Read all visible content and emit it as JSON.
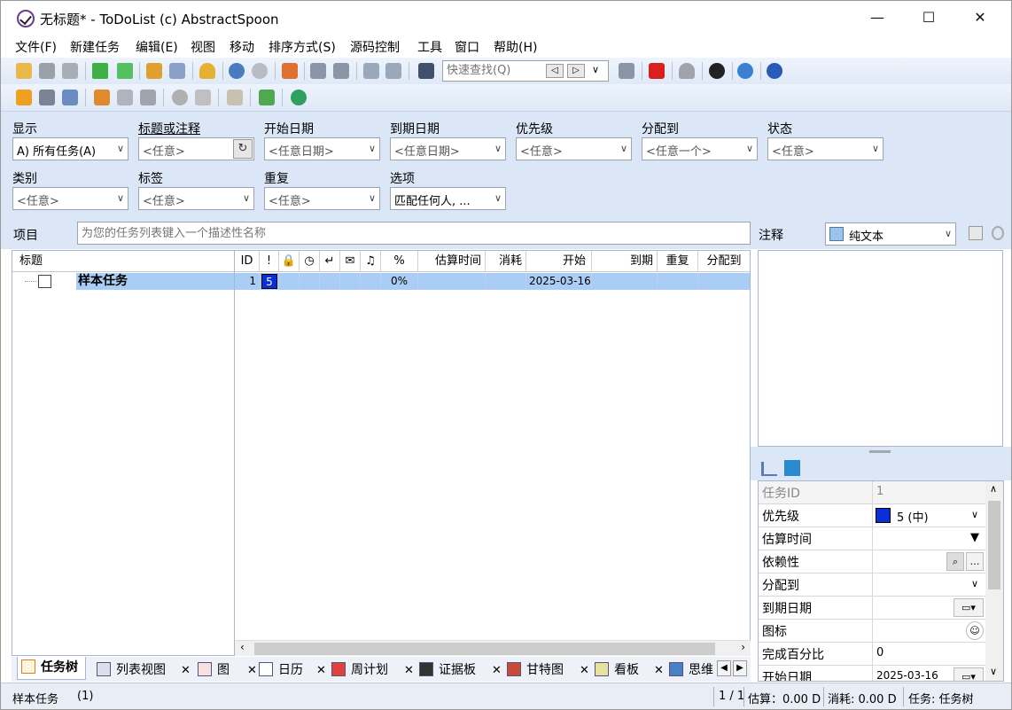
{
  "window": {
    "title": "无标题* - ToDoList (c) AbstractSpoon",
    "minimize": "—",
    "maximize": "☐",
    "close": "✕"
  },
  "menu": [
    "文件(F)",
    "新建任务",
    "编辑(E)",
    "视图",
    "移动",
    "排序方式(S)",
    "源码控制",
    "工具",
    "窗口",
    "帮助(H)"
  ],
  "quickfind": {
    "placeholder": "快速查找(Q)"
  },
  "filters": {
    "show": {
      "label": "显示",
      "value": "A) 所有任务(A)"
    },
    "title_or_comments": {
      "label": "标题或注释",
      "value": "<任意>"
    },
    "start_date": {
      "label": "开始日期",
      "value": "<任意日期>"
    },
    "due_date": {
      "label": "到期日期",
      "value": "<任意日期>"
    },
    "priority": {
      "label": "优先级",
      "value": "<任意>"
    },
    "assigned_to": {
      "label": "分配到",
      "value": "<任意一个>"
    },
    "status": {
      "label": "状态",
      "value": "<任意>"
    },
    "category": {
      "label": "类别",
      "value": "<任意>"
    },
    "tags": {
      "label": "标签",
      "value": "<任意>"
    },
    "recurrence": {
      "label": "重复",
      "value": "<任意>"
    },
    "options": {
      "label": "选项",
      "value": "匹配任何人, ..."
    }
  },
  "project": {
    "label": "项目",
    "placeholder": "为您的任务列表键入一个描述性名称"
  },
  "columns": {
    "title": "标题",
    "id": "ID",
    "pct": "%",
    "estimate": "估算时间",
    "spent": "消耗",
    "start": "开始",
    "due": "到期",
    "recur": "重复",
    "assigned": "分配到"
  },
  "task": {
    "title": "样本任务",
    "id": "1",
    "priority": "5",
    "percent": "0%",
    "start": "2025-03-16"
  },
  "tabs": [
    {
      "label": "任务树",
      "active": true
    },
    {
      "label": "列表视图"
    },
    {
      "label": "图"
    },
    {
      "label": "日历"
    },
    {
      "label": "周计划"
    },
    {
      "label": "证据板"
    },
    {
      "label": "甘特图"
    },
    {
      "label": "看板"
    },
    {
      "label": "思维"
    }
  ],
  "notes": {
    "label": "注释",
    "format": "纯文本"
  },
  "inspector": {
    "task_id": {
      "name": "任务ID",
      "value": "1"
    },
    "priority": {
      "name": "优先级",
      "value": "5 (中)"
    },
    "estimate": {
      "name": "估算时间",
      "value": ""
    },
    "dependency": {
      "name": "依赖性",
      "value": ""
    },
    "assigned": {
      "name": "分配到",
      "value": ""
    },
    "due_date": {
      "name": "到期日期",
      "value": ""
    },
    "icon": {
      "name": "图标",
      "value": ""
    },
    "percent": {
      "name": "完成百分比",
      "value": "0"
    },
    "start_date": {
      "name": "开始日期",
      "value": "2025-03-16"
    }
  },
  "status": {
    "task": "样本任务",
    "count": "(1)",
    "pages": "1 / 1",
    "estimate": "估算：0.00 D",
    "spent": "消耗: 0.00 D",
    "view": "任务: 任务树"
  },
  "colors": {
    "priority_5": "#0a2fd8",
    "selection": "#a9cdf5",
    "panel": "#dbe7f7"
  }
}
